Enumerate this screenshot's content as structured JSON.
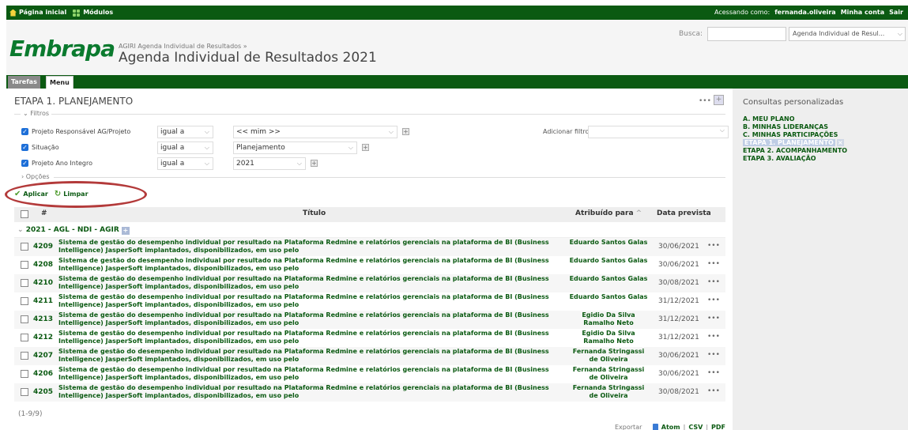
{
  "topbar": {
    "home": "Página inicial",
    "modules": "Módulos",
    "logged_as_label": "Acessando como:",
    "user": "fernanda.oliveira",
    "my_account": "Minha conta",
    "logout": "Sair"
  },
  "header": {
    "logo": "Embrapa",
    "breadcrumb": "AGIRI Agenda Individual de Resultados »",
    "title": "Agenda Individual de Resultados 2021",
    "search_label": "Busca:",
    "search_value": "",
    "project_select": "Agenda Individual de Resul..."
  },
  "tabs": {
    "tarefas": "Tarefas",
    "menu": "Menu"
  },
  "main": {
    "page_title": "ETAPA 1. PLANEJAMENTO",
    "filters_legend": "Filtros",
    "filters": [
      {
        "label": "Projeto Responsável AG/Projeto",
        "operator": "igual a",
        "value": "<< mim >>"
      },
      {
        "label": "Situação",
        "operator": "igual a",
        "value": "Planejamento"
      },
      {
        "label": "Projeto Ano Integro",
        "operator": "igual a",
        "value": "2021"
      }
    ],
    "add_filter_label": "Adicionar filtro",
    "options_legend": "Opções",
    "apply": "Aplicar",
    "clear": "Limpar"
  },
  "table": {
    "headers": {
      "num": "#",
      "title": "Título",
      "assigned": "Atribuído para",
      "date": "Data prevista"
    },
    "group": "2021 - AGL - NDI - AGIR",
    "rows": [
      {
        "id": "4209",
        "title": "Sistema de gestão do desempenho individual por resultado na Plataforma Redmine e relatórios gerenciais na plataforma de BI (Business Intelligence) JasperSoft implantados, disponibilizados, em uso pelo",
        "assigned": "Eduardo Santos Galas",
        "date": "30/06/2021"
      },
      {
        "id": "4208",
        "title": "Sistema de gestão do desempenho individual por resultado na Plataforma Redmine e relatórios gerenciais na plataforma de BI (Business Intelligence) JasperSoft implantados, disponibilizados, em uso pelo",
        "assigned": "Eduardo Santos Galas",
        "date": "30/06/2021"
      },
      {
        "id": "4210",
        "title": "Sistema de gestão do desempenho individual por resultado na Plataforma Redmine e relatórios gerenciais na plataforma de BI (Business Intelligence) JasperSoft implantados, disponibilizados, em uso pelo",
        "assigned": "Eduardo Santos Galas",
        "date": "30/08/2021"
      },
      {
        "id": "4211",
        "title": "Sistema de gestão do desempenho individual por resultado na Plataforma Redmine e relatórios gerenciais na plataforma de BI (Business Intelligence) JasperSoft implantados, disponibilizados, em uso pelo",
        "assigned": "Eduardo Santos Galas",
        "date": "31/12/2021"
      },
      {
        "id": "4213",
        "title": "Sistema de gestão do desempenho individual por resultado na Plataforma Redmine e relatórios gerenciais na plataforma de BI (Business Intelligence) JasperSoft implantados, disponibilizados, em uso pelo",
        "assigned": "Egidio Da Silva Ramalho Neto",
        "date": "31/12/2021"
      },
      {
        "id": "4212",
        "title": "Sistema de gestão do desempenho individual por resultado na Plataforma Redmine e relatórios gerenciais na plataforma de BI (Business Intelligence) JasperSoft implantados, disponibilizados, em uso pelo",
        "assigned": "Egidio Da Silva Ramalho Neto",
        "date": "31/12/2021"
      },
      {
        "id": "4207",
        "title": "Sistema de gestão do desempenho individual por resultado na Plataforma Redmine e relatórios gerenciais na plataforma de BI (Business Intelligence) JasperSoft implantados, disponibilizados, em uso pelo",
        "assigned": "Fernanda Stringassi de Oliveira",
        "date": "30/06/2021"
      },
      {
        "id": "4206",
        "title": "Sistema de gestão do desempenho individual por resultado na Plataforma Redmine e relatórios gerenciais na plataforma de BI (Business Intelligence) JasperSoft implantados, disponibilizados, em uso pelo",
        "assigned": "Fernanda Stringassi de Oliveira",
        "date": "30/06/2021"
      },
      {
        "id": "4205",
        "title": "Sistema de gestão do desempenho individual por resultado na Plataforma Redmine e relatórios gerenciais na plataforma de BI (Business Intelligence) JasperSoft implantados, disponibilizados, em uso pelo",
        "assigned": "Fernanda Stringassi de Oliveira",
        "date": "30/08/2021"
      }
    ],
    "row_menu": "•••",
    "count": "(1-9/9)"
  },
  "export": {
    "label": "Exportar para",
    "atom": "Atom",
    "csv": "CSV",
    "pdf": "PDF",
    "sep": "|"
  },
  "sidebar": {
    "title": "Consultas personalizadas",
    "items": [
      {
        "label": "A. MEU PLANO"
      },
      {
        "label": "B. MINHAS LIDERANÇAS"
      },
      {
        "label": "C. MINHAS PARTICIPAÇÕES"
      },
      {
        "label": "ETAPA 1. PLANEJAMENTO"
      },
      {
        "label": "ETAPA 2. ACOMPANHAMENTO"
      },
      {
        "label": "ETAPA 3. AVALIAÇÃO"
      }
    ]
  },
  "colors": {
    "brand_green": "#0b5a12",
    "annotation_red": "#b33a3a"
  },
  "icons": [
    "home-icon",
    "modules-icon",
    "chevron-down-icon",
    "plus-icon",
    "check-icon",
    "refresh-icon",
    "atom-icon",
    "close-icon"
  ]
}
